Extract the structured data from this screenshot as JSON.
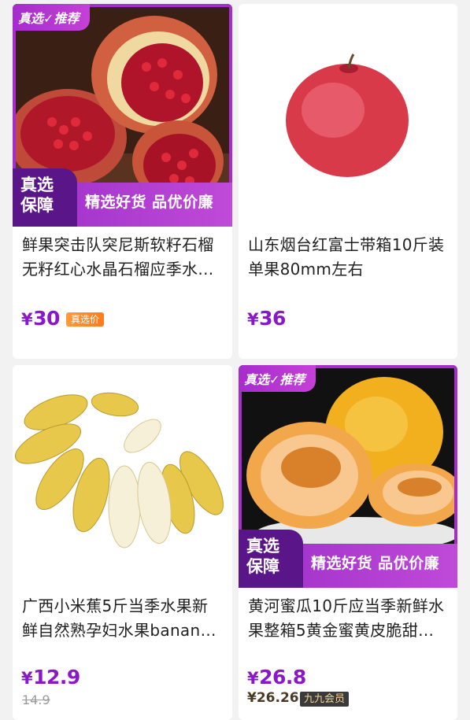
{
  "products": [
    {
      "title": "鲜果突击队突尼斯软籽石榴无籽红心水晶石榴应季水…",
      "currency": "¥",
      "price": "30",
      "price_tag": "真选价",
      "promo_top": "真选✓推荐",
      "promo_badge": "真选保障",
      "promo_slogan": "精选好货 品优价廉"
    },
    {
      "title": "山东烟台红富士带箱10斤装单果80mm左右",
      "currency": "¥",
      "price": "36"
    },
    {
      "title": "广西小米蕉5斤当季水果新鲜自然熟孕妇水果banan…",
      "currency": "¥",
      "price": "12.9",
      "original_price": "14.9"
    },
    {
      "title": "黄河蜜瓜10斤应当季新鲜水果整箱5黄金蜜黄皮脆甜…",
      "currency": "¥",
      "price": "26.8",
      "member_price": "¥26.26",
      "member_label": "九九会员",
      "promo_top": "真选✓推荐",
      "promo_badge": "真选保障",
      "promo_slogan": "精选好货 品优价廉"
    }
  ],
  "colors": {
    "price": "#8a17c9",
    "promo": "#a62ccc",
    "tag": "#ff8a2a"
  }
}
